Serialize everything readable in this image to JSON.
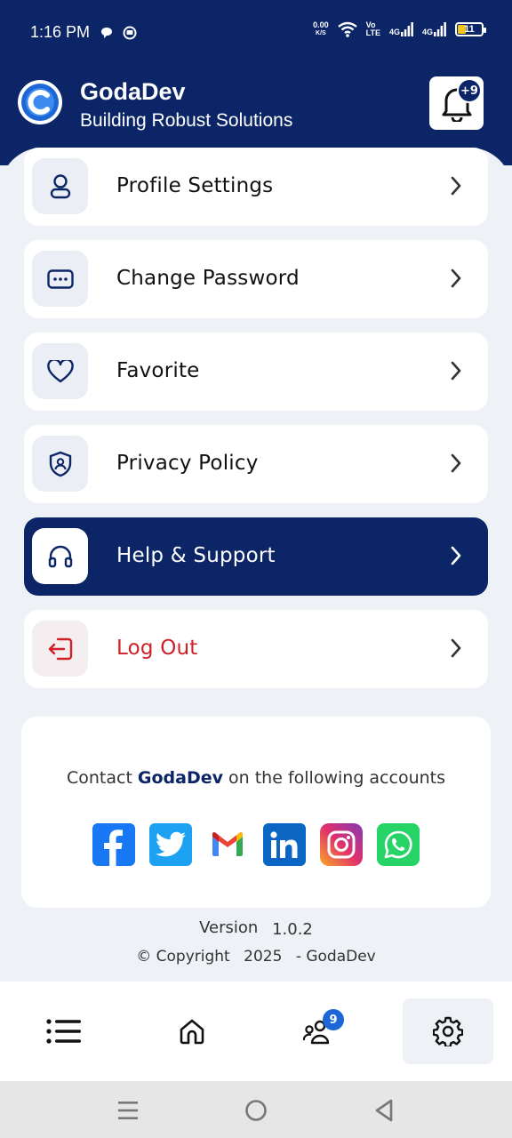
{
  "status_bar": {
    "time": "1:16 PM",
    "net_speed_value": "0.00",
    "net_speed_unit": "K/S",
    "volte_top": "Vo",
    "volte_bottom": "LTE",
    "signal_1": "4G",
    "signal_2": "4G",
    "battery_level": "11"
  },
  "header": {
    "app_name": "GodaDev",
    "tagline": "Building Robust Solutions",
    "notification_badge": "+9"
  },
  "menu": {
    "items": [
      {
        "label": "Profile Settings",
        "icon": "person-icon"
      },
      {
        "label": "Change Password",
        "icon": "password-icon"
      },
      {
        "label": "Favorite",
        "icon": "heart-icon"
      },
      {
        "label": "Privacy Policy",
        "icon": "shield-user-icon"
      },
      {
        "label": "Help & Support",
        "icon": "headphones-icon"
      },
      {
        "label": "Log Out",
        "icon": "logout-icon"
      }
    ]
  },
  "contact": {
    "prefix": "Contact",
    "brand": "GodaDev",
    "suffix": "on the following accounts",
    "socials": [
      "facebook",
      "twitter",
      "gmail",
      "linkedin",
      "instagram",
      "whatsapp"
    ]
  },
  "footer": {
    "version_label": "Version",
    "version_number": "1.0.2",
    "copyright_label": "© Copyright",
    "copyright_year": "2025",
    "copyright_owner": "- GodaDev"
  },
  "bottom_nav": {
    "people_badge": "9"
  },
  "colors": {
    "primary": "#0b2567",
    "logout": "#d01f26",
    "badge": "#1d66d6"
  }
}
